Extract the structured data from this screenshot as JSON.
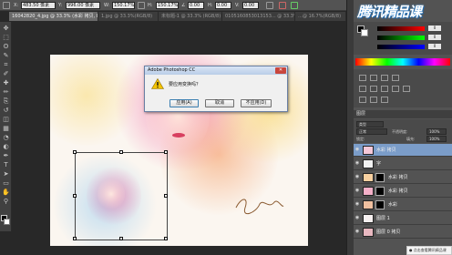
{
  "options_bar": {
    "x_label": "X:",
    "x_value": "483.50 像素",
    "y_label": "Y:",
    "y_value": "996.00 像素",
    "w_label": "W:",
    "w_value": "150.17%",
    "h_label": "H:",
    "h_value": "150.17%",
    "angle_value": "0.00",
    "h2_label": "H:",
    "h2_value": "0.00",
    "v_label": "V:",
    "v_value": "0.00"
  },
  "tabs": [
    {
      "label": "16042820_4.jpg @ 33.3% (水彩 拷贝, RGB/8) *",
      "active": true
    },
    {
      "label": "1.jpg @ 33.3%(RGB/8)",
      "active": false
    },
    {
      "label": "未标题-1 @ 33.3% (RGB/8) *",
      "active": false
    },
    {
      "label": "0105160853013153... @ 33.3%",
      "active": false
    },
    {
      "label": "…@ 16.7%(RGB/8)",
      "active": false
    }
  ],
  "tools": [
    "move-tool-icon",
    "marquee-tool-icon",
    "lasso-tool-icon",
    "quick-select-tool-icon",
    "crop-tool-icon",
    "eyedropper-tool-icon",
    "healing-tool-icon",
    "brush-tool-icon",
    "clone-stamp-tool-icon",
    "history-brush-tool-icon",
    "eraser-tool-icon",
    "gradient-tool-icon",
    "blur-tool-icon",
    "dodge-tool-icon",
    "pen-tool-icon",
    "type-tool-icon",
    "path-select-tool-icon",
    "shape-tool-icon",
    "hand-tool-icon",
    "zoom-tool-icon"
  ],
  "tool_glyphs": [
    "✥",
    "⬚",
    "ʘ",
    "✎",
    "⌗",
    "✐",
    "✚",
    "✏",
    "⎘",
    "↺",
    "◫",
    "▦",
    "◔",
    "◐",
    "✒",
    "T",
    "➤",
    "▭",
    "✋",
    "⚲"
  ],
  "dialog": {
    "title": "Adobe Photoshop CC",
    "close_label": "✕",
    "message": "要应用变换吗？",
    "apply_label": "应用(A)",
    "cancel_label": "取消",
    "dont_apply_label": "不应用(D)"
  },
  "watermark": "腾讯精品课",
  "layers_panel": {
    "header": "图层",
    "kind_label": "类型",
    "blend_mode": "正常",
    "opacity_label": "不透明度:",
    "opacity_value": "100%",
    "lock_label": "锁定:",
    "fill_label": "填充:",
    "fill_value": "100%",
    "layers": [
      {
        "name": "水彩 拷贝",
        "active": true,
        "mask": false,
        "thumb": "#f5c8d8"
      },
      {
        "name": "字",
        "active": false,
        "mask": false,
        "thumb": "#f2f2f2"
      },
      {
        "name": "水彩 拷贝",
        "active": false,
        "mask": true,
        "thumb": "#f7d0a0"
      },
      {
        "name": "水彩 拷贝",
        "active": false,
        "mask": true,
        "thumb": "#f4b0c8"
      },
      {
        "name": "水彩",
        "active": false,
        "mask": true,
        "thumb": "#f0c0a0"
      },
      {
        "name": "图层 1",
        "active": false,
        "mask": false,
        "thumb": "#f6f0f0"
      },
      {
        "name": "图层 0 拷贝",
        "active": false,
        "mask": false,
        "thumb": "#e8b8c0"
      }
    ]
  },
  "color_panel": {
    "sliders": [
      {
        "name": "red",
        "value": "0"
      },
      {
        "name": "green",
        "value": "0"
      },
      {
        "name": "blue",
        "value": "0"
      }
    ]
  },
  "status_tip": "● 点击查看腾讯精品课"
}
